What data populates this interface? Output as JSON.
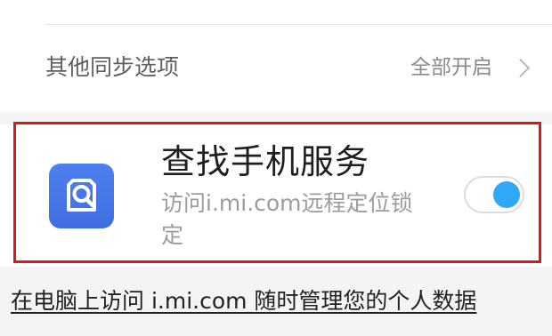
{
  "sync_options": {
    "label": "其他同步选项",
    "value": "全部开启",
    "chevron_icon": "chevron-right-icon"
  },
  "find_device": {
    "title": "查找手机服务",
    "description": "访问i.mi.com远程定位锁定",
    "app_icon": "find-device-search-icon",
    "icon_color": "#4676e8",
    "toggle_state": "on",
    "toggle_color": "#2fa8f5",
    "highlight_color": "#d8171c"
  },
  "footer": {
    "link_text": "在电脑上访问 i.mi.com 随时管理您的个人数据"
  }
}
